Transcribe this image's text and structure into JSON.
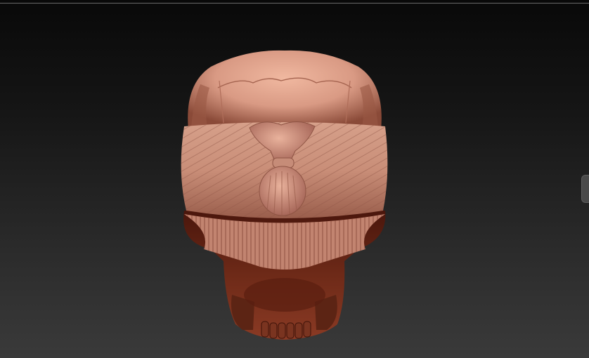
{
  "viewport": {
    "background_top": "#090909",
    "background_bottom": "#3a3a3a"
  },
  "model": {
    "subject": "sculpted-skull-with-blindfold",
    "skin_color": "#d49a85",
    "shadow_color": "#5a1e10"
  },
  "side_panel_tab": {
    "icon": "collapse-tab"
  }
}
